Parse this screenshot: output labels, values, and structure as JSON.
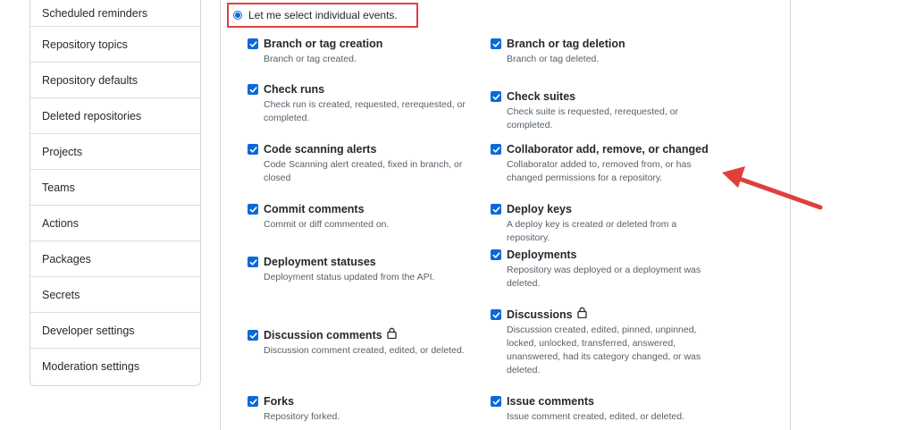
{
  "sidebar": {
    "items": [
      {
        "label": "Scheduled reminders"
      },
      {
        "label": "Repository topics"
      },
      {
        "label": "Repository defaults"
      },
      {
        "label": "Deleted repositories"
      },
      {
        "label": "Projects"
      },
      {
        "label": "Teams"
      },
      {
        "label": "Actions"
      },
      {
        "label": "Packages"
      },
      {
        "label": "Secrets"
      },
      {
        "label": "Developer settings"
      },
      {
        "label": "Moderation settings"
      }
    ]
  },
  "events_option": {
    "label": "Let me select individual events.",
    "selected": true
  },
  "events": {
    "left": [
      {
        "title": "Branch or tag creation",
        "desc": [
          "Branch or tag created."
        ],
        "checked": true
      },
      {
        "title": "Check runs",
        "desc": [
          "Check run is created, requested, rerequested, or",
          "completed."
        ],
        "checked": true
      },
      {
        "title": "Code scanning alerts",
        "desc": [
          "Code Scanning alert created, fixed in branch, or",
          "closed"
        ],
        "checked": true
      },
      {
        "title": "Commit comments",
        "desc": [
          "Commit or diff commented on."
        ],
        "checked": true
      },
      {
        "title": "Deployment statuses",
        "desc": [
          "Deployment status updated from the API."
        ],
        "checked": true
      },
      {
        "title": "Discussion comments",
        "desc": [
          "Discussion comment created, edited, or deleted."
        ],
        "checked": true,
        "icon": "lock-icon"
      },
      {
        "title": "Forks",
        "desc": [
          "Repository forked."
        ],
        "checked": true
      }
    ],
    "right": [
      {
        "title": "Branch or tag deletion",
        "desc": [
          "Branch or tag deleted."
        ],
        "checked": true
      },
      {
        "title": "Check suites",
        "desc": [
          "Check suite is requested, rerequested, or completed."
        ],
        "checked": true
      },
      {
        "title": "Collaborator add, remove, or changed",
        "desc": [
          "Collaborator added to, removed from, or has",
          "changed permissions for a repository."
        ],
        "checked": true
      },
      {
        "title": "Deploy keys",
        "desc": [
          "A deploy key is created or deleted from a repository."
        ],
        "checked": true
      },
      {
        "title": "Deployments",
        "desc": [
          "Repository was deployed or a deployment was",
          "deleted."
        ],
        "checked": true
      },
      {
        "title": "Discussions",
        "desc": [
          "Discussion created, edited, pinned, unpinned,",
          "locked, unlocked, transferred, answered,",
          "unanswered, had its category changed, or was",
          "deleted."
        ],
        "checked": true,
        "icon": "lock-icon"
      },
      {
        "title": "Issue comments",
        "desc": [
          "Issue comment created, edited, or deleted."
        ],
        "checked": true
      }
    ]
  },
  "colors": {
    "accent": "#0969da",
    "highlight": "#e0403c"
  }
}
